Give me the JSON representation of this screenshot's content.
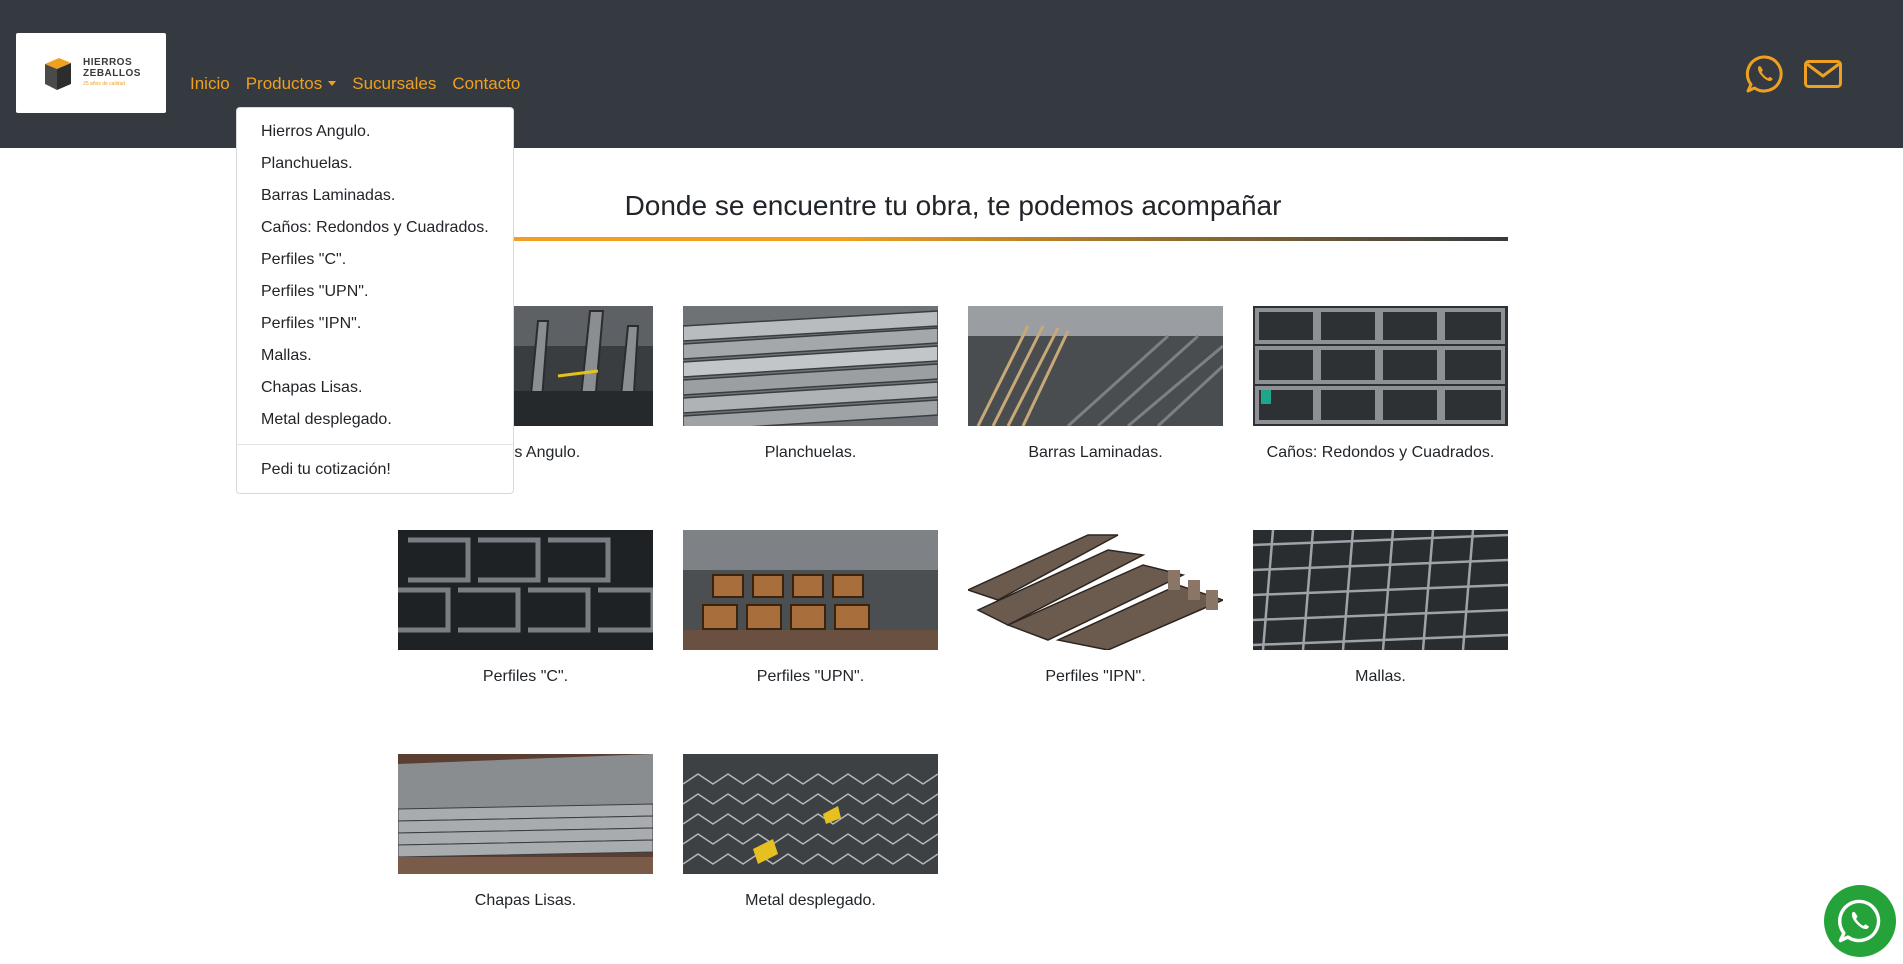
{
  "brand": {
    "logo_line1": "HIERROS",
    "logo_line2": "ZEBALLOS",
    "logo_tagline": "25 años de calidad",
    "accent_color": "#f0a020",
    "navbar_color": "#343a40"
  },
  "nav": {
    "items": [
      {
        "label": "Inicio"
      },
      {
        "label": "Productos"
      },
      {
        "label": "Sucursales"
      },
      {
        "label": "Contacto"
      }
    ],
    "icons": [
      "whatsapp-icon",
      "envelope-icon"
    ]
  },
  "dropdown": {
    "items": [
      {
        "label": "Hierros Angulo."
      },
      {
        "label": "Planchuelas."
      },
      {
        "label": "Barras Laminadas."
      },
      {
        "label": "Caños: Redondos y Cuadrados."
      },
      {
        "label": "Perfiles \"C\"."
      },
      {
        "label": "Perfiles \"UPN\"."
      },
      {
        "label": "Perfiles \"IPN\"."
      },
      {
        "label": "Mallas."
      },
      {
        "label": "Chapas Lisas."
      },
      {
        "label": "Metal desplegado."
      }
    ],
    "footer_item": "Pedi tu cotización!"
  },
  "main": {
    "title": "Donde se encuentre tu obra, te podemos acompañar",
    "products": [
      {
        "caption": "Hierros Angulo."
      },
      {
        "caption": "Planchuelas."
      },
      {
        "caption": "Barras Laminadas."
      },
      {
        "caption": "Caños: Redondos y Cuadrados."
      },
      {
        "caption": "Perfiles \"C\"."
      },
      {
        "caption": "Perfiles \"UPN\"."
      },
      {
        "caption": "Perfiles \"IPN\"."
      },
      {
        "caption": "Mallas."
      },
      {
        "caption": "Chapas Lisas."
      },
      {
        "caption": "Metal desplegado."
      }
    ]
  },
  "floating": {
    "icon": "whatsapp-icon",
    "color": "#25a23a"
  }
}
